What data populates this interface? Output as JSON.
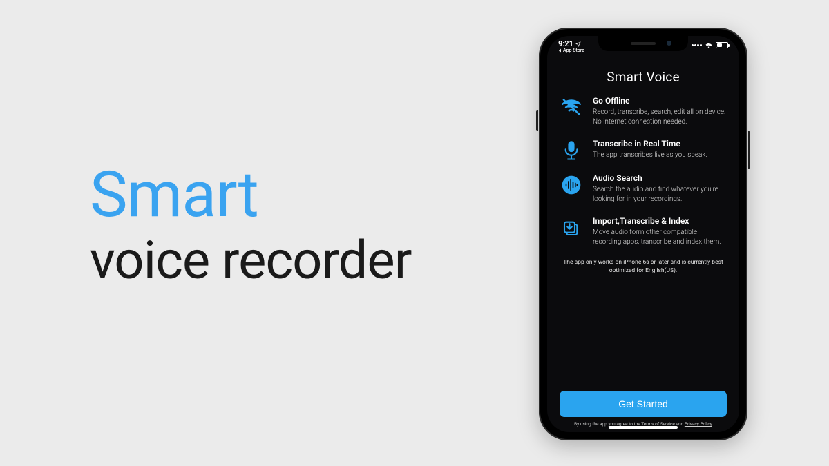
{
  "hero": {
    "line1": "Smart",
    "line2": "voice recorder"
  },
  "status": {
    "time": "9:21",
    "back_label": "App Store"
  },
  "app": {
    "title": "Smart Voice",
    "features": [
      {
        "icon": "wifi-off-icon",
        "title": "Go Offline",
        "desc": "Record, transcribe, search, edit all on device. No internet connection needed."
      },
      {
        "icon": "microphone-icon",
        "title": "Transcribe in Real Time",
        "desc": "The app transcribes live as you speak."
      },
      {
        "icon": "waveform-icon",
        "title": "Audio Search",
        "desc": "Search the audio and find whatever you're looking for in your recordings."
      },
      {
        "icon": "import-icon",
        "title": "Import,Transcribe & Index",
        "desc": "Move audio form other compatible recording apps, transcribe and index them."
      }
    ],
    "disclaimer": "The app only works on iPhone 6s or later and is currently best optimized for English(US).",
    "cta_label": "Get Started",
    "legal_prefix": "By using the app you agree to the ",
    "legal_tos": "Terms of Service",
    "legal_and": " and ",
    "legal_pp": "Privacy Policy"
  },
  "colors": {
    "accent": "#2aa4ef"
  }
}
